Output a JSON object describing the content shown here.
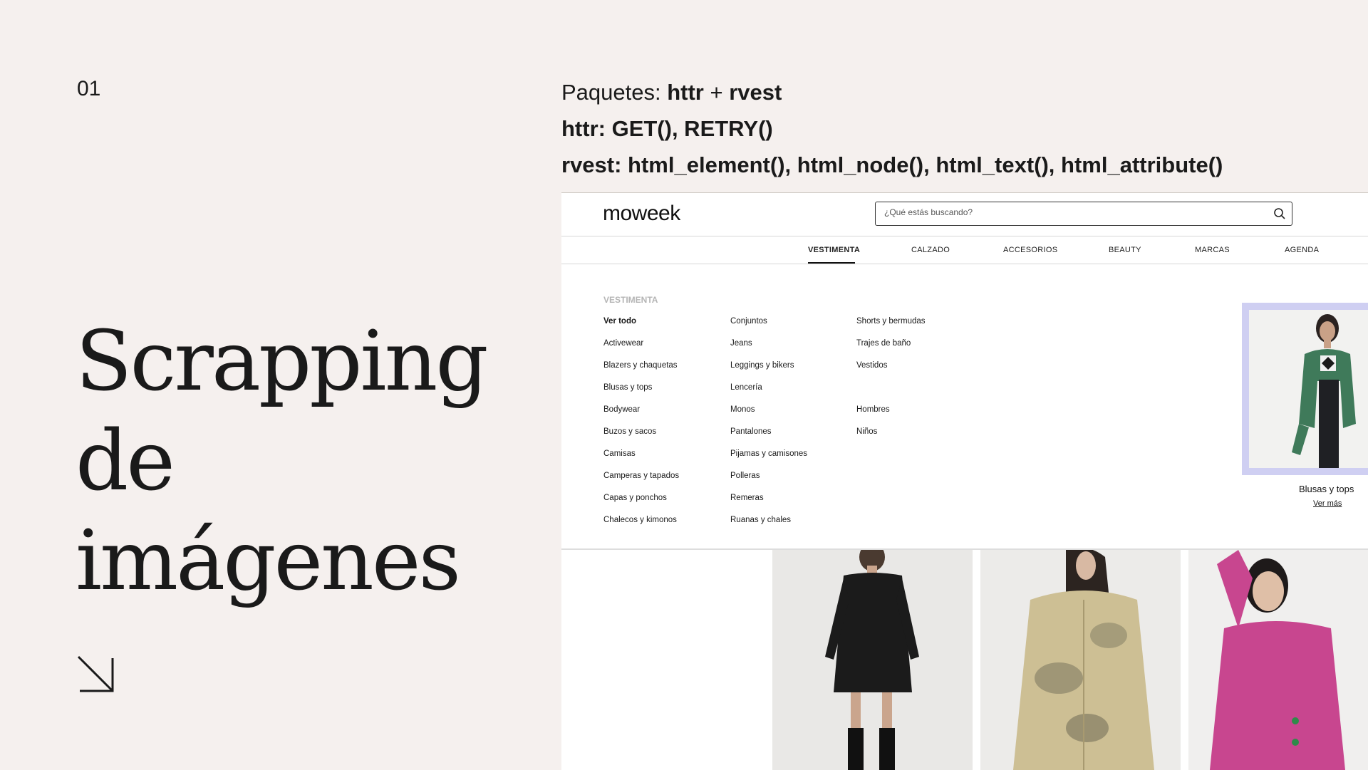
{
  "slide": {
    "number": "01",
    "title_line1": "Scrapping de",
    "title_line2": "imágenes",
    "code_line1_prefix": "Paquetes: ",
    "code_line1_a": "httr",
    "code_line1_plus": " + ",
    "code_line1_b": "rvest",
    "code_line2": "httr: GET(), RETRY()",
    "code_line3": "rvest: html_element(), html_node(), html_text(), html_attribute()",
    "arrow_icon": "arrow-down-right-icon"
  },
  "site": {
    "logo": "moweek",
    "search": {
      "placeholder": "¿Qué estás buscando?",
      "icon": "search-icon"
    },
    "nav": [
      "VESTIMENTA",
      "CALZADO",
      "ACCESORIOS",
      "BEAUTY",
      "MARCAS",
      "AGENDA"
    ],
    "menu": {
      "heading": "VESTIMENTA",
      "col1": [
        "Ver todo",
        "Activewear",
        "Blazers y chaquetas",
        "Blusas y tops",
        "Bodywear",
        "Buzos y sacos",
        "Camisas",
        "Camperas y tapados",
        "Capas y ponchos",
        "Chalecos y kimonos"
      ],
      "col2": [
        "Conjuntos",
        "Jeans",
        "Leggings y bikers",
        "Lencería",
        "Monos",
        "Pantalones",
        "Pijamas y camisones",
        "Polleras",
        "Remeras",
        "Ruanas y chales"
      ],
      "col3": [
        "Shorts y bermudas",
        "Trajes de baño",
        "Vestidos"
      ],
      "col3b": [
        "Hombres",
        "Niños"
      ]
    },
    "promo": {
      "caption": "Blusas y tops",
      "link": "Ver más"
    },
    "colors": {
      "accent_frame": "#cfcff2",
      "text": "#1a1a1a",
      "background": "#f5f0ee"
    }
  }
}
